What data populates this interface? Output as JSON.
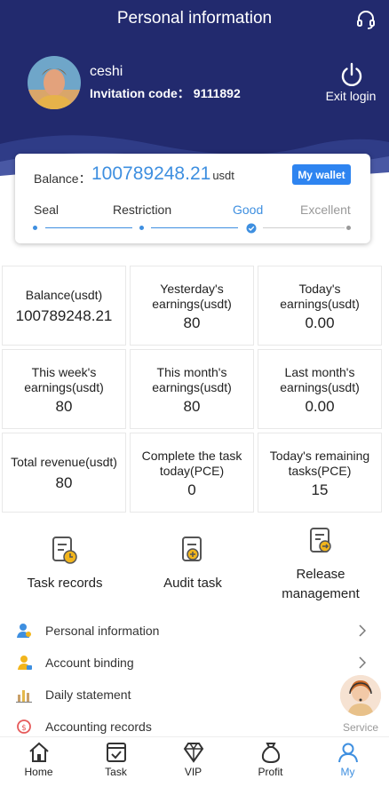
{
  "header": {
    "title": "Personal information",
    "username": "ceshi",
    "invitation_label": "Invitation code：",
    "invitation_code": "9111892",
    "exit_label": "Exit login"
  },
  "balance_card": {
    "label": "Balance：",
    "value": "100789248.21",
    "unit": "usdt",
    "wallet_button": "My wallet",
    "levels": [
      "Seal",
      "Restriction",
      "Good",
      "Excellent"
    ],
    "current_level": "Good",
    "accent_color": "#3e8fe0"
  },
  "stats": [
    {
      "label": "Balance(usdt)",
      "value": "100789248.21"
    },
    {
      "label": "Yesterday's earnings(usdt)",
      "value": "80"
    },
    {
      "label": "Today's earnings(usdt)",
      "value": "0.00"
    },
    {
      "label": "This week's earnings(usdt)",
      "value": "80"
    },
    {
      "label": "This month's earnings(usdt)",
      "value": "80"
    },
    {
      "label": "Last month's earnings(usdt)",
      "value": "0.00"
    },
    {
      "label": "Total revenue(usdt)",
      "value": "80"
    },
    {
      "label": "Complete the task today(PCE)",
      "value": "0"
    },
    {
      "label": "Today's remaining tasks(PCE)",
      "value": "15"
    }
  ],
  "actions": [
    {
      "label": "Task records",
      "icon": "task-records-icon"
    },
    {
      "label": "Audit task",
      "icon": "audit-task-icon"
    },
    {
      "label": "Release management",
      "icon": "release-management-icon"
    }
  ],
  "menu": [
    {
      "label": "Personal information",
      "icon": "user-icon"
    },
    {
      "label": "Account binding",
      "icon": "account-binding-icon"
    },
    {
      "label": "Daily statement",
      "icon": "daily-statement-icon"
    },
    {
      "label": "Accounting records",
      "icon": "accounting-records-icon"
    }
  ],
  "service": {
    "label": "Service"
  },
  "tabbar": [
    {
      "label": "Home",
      "icon": "home-icon"
    },
    {
      "label": "Task",
      "icon": "task-icon"
    },
    {
      "label": "VIP",
      "icon": "diamond-icon"
    },
    {
      "label": "Profit",
      "icon": "money-bag-icon"
    },
    {
      "label": "My",
      "icon": "person-icon",
      "active": true
    }
  ],
  "colors": {
    "header_bg": "#222a6e",
    "primary": "#2e84f0",
    "accent": "#3e8fe0"
  }
}
